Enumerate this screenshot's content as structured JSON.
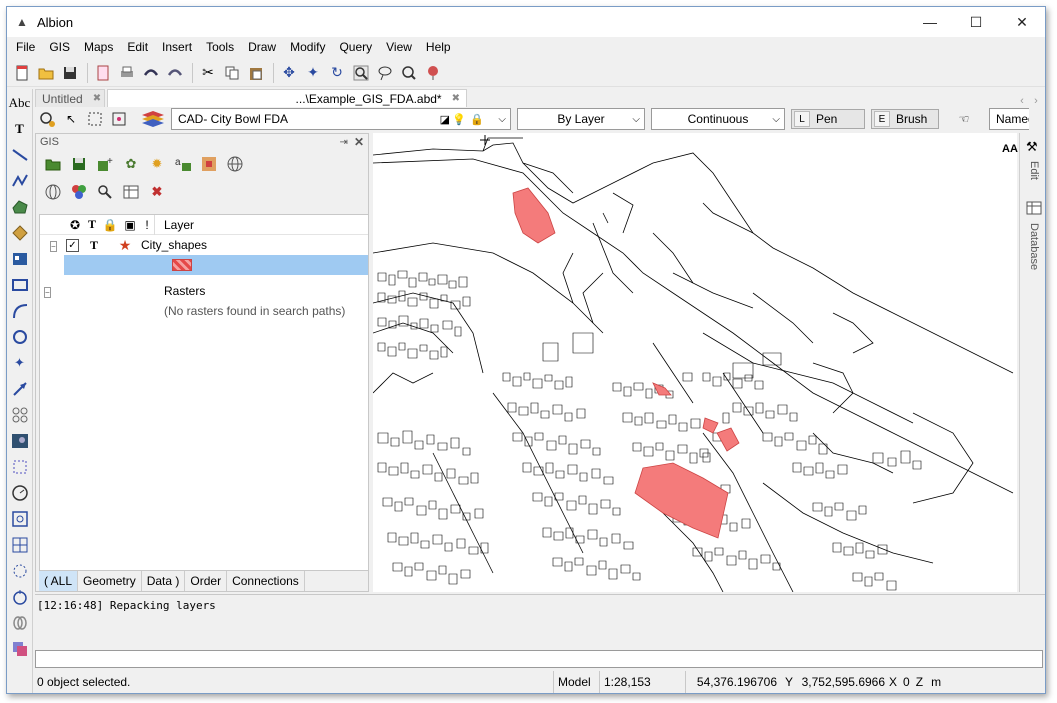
{
  "window": {
    "title": "Albion",
    "app_icon": "albion-icon",
    "controls": {
      "minimize": "—",
      "maximize": "☐",
      "close": "✕"
    }
  },
  "menubar": {
    "items": [
      "File",
      "GIS",
      "Maps",
      "Edit",
      "Insert",
      "Tools",
      "Draw",
      "Modify",
      "Query",
      "View",
      "Help"
    ]
  },
  "main_toolbar": {
    "icons": [
      "new-file-icon",
      "open-folder-icon",
      "save-icon",
      "page-setup-icon",
      "print-icon",
      "undo-icon",
      "redo-icon",
      "cut-icon",
      "copy-icon",
      "paste-icon",
      "pan-icon",
      "zoom-extents-icon",
      "refresh-icon",
      "zoom-window-icon",
      "zoom-lasso-icon",
      "zoom-in-out-icon",
      "pin-icon"
    ]
  },
  "left_tools": {
    "icons": [
      "text-abc-icon",
      "text-style-icon",
      "line-icon",
      "polyline-icon",
      "polygon-icon",
      "diamond-icon",
      "block-icon",
      "rectangle-icon",
      "arc-icon",
      "circle-icon",
      "point-icon",
      "arrow-icon",
      "group-icon",
      "image-icon",
      "selection-icon",
      "dial-icon",
      "snap-icon",
      "grid-icon",
      "node-icon",
      "compass-icon",
      "link-icon",
      "layers-icon"
    ],
    "labels": {
      "text_abc": "Abc",
      "text_style": "T"
    }
  },
  "tabs": {
    "items": [
      {
        "label": "Untitled",
        "close": "✖"
      },
      {
        "label": "...\\Example_GIS_FDA.abd*",
        "close": "✖"
      }
    ]
  },
  "propbar": {
    "layer_combo": "CAD- City Bowl FDA",
    "color_combo": "By Layer",
    "linetype_combo": "Continuous",
    "pen_key": "L",
    "pen_label": "Pen",
    "brush_key": "E",
    "brush_label": "Brush",
    "named_combo": "Named"
  },
  "gis_panel": {
    "title": "GIS",
    "header": {
      "layer_col": "Layer",
      "icons": [
        "star-icon",
        "T",
        "lock-icon",
        "db-icon",
        "!"
      ]
    },
    "layers": [
      {
        "name": "City_shapes",
        "checked": true,
        "type": "T"
      }
    ],
    "rasters_label": "Rasters",
    "rasters_note": "(No rasters found in search paths)",
    "tabs": [
      "( ALL",
      "Geometry",
      "Data )",
      "Order",
      "Connections"
    ]
  },
  "map": {
    "zoom_label": "AA",
    "fill_color": "#f47b7b",
    "line_color": "#000000"
  },
  "right_dock": {
    "edit_label": "Edit",
    "database_label": "Database"
  },
  "console": {
    "log_line": "[12:16:48] Repacking layers"
  },
  "status": {
    "selection": "0 object selected.",
    "space": "Model",
    "scale": "1:28,153",
    "x_value": "54,376.196706",
    "y_label": "Y",
    "y_value": "3,752,595.6966",
    "x_label": "X",
    "z_value": "0",
    "z_label": "Z",
    "units": "m"
  }
}
